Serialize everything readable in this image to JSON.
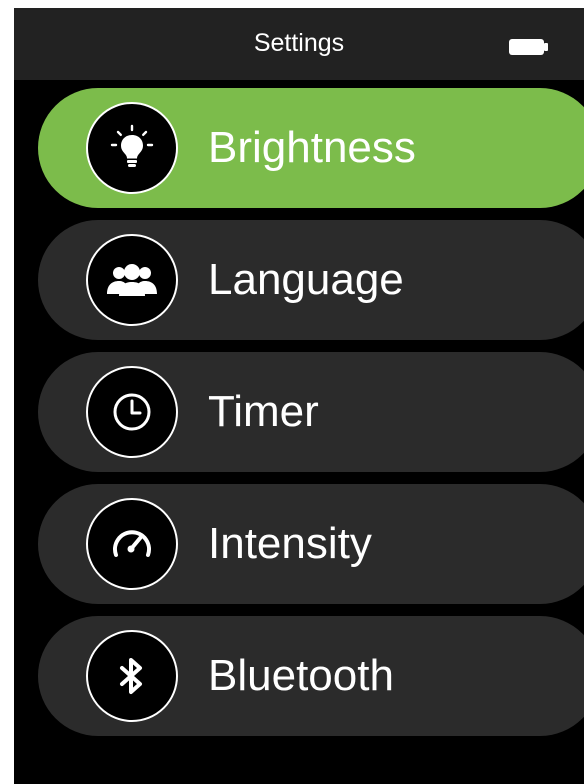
{
  "header": {
    "title": "Settings"
  },
  "colors": {
    "selected": "#7cbc4b",
    "item_bg": "#2b2b2b",
    "header_bg": "#222222",
    "screen_bg": "#000000",
    "text": "#ffffff"
  },
  "menu": {
    "items": [
      {
        "label": "Brightness",
        "icon": "lightbulb-icon",
        "selected": true
      },
      {
        "label": "Language",
        "icon": "users-icon",
        "selected": false
      },
      {
        "label": "Timer",
        "icon": "clock-icon",
        "selected": false
      },
      {
        "label": "Intensity",
        "icon": "gauge-icon",
        "selected": false
      },
      {
        "label": "Bluetooth",
        "icon": "bluetooth-icon",
        "selected": false
      }
    ]
  }
}
